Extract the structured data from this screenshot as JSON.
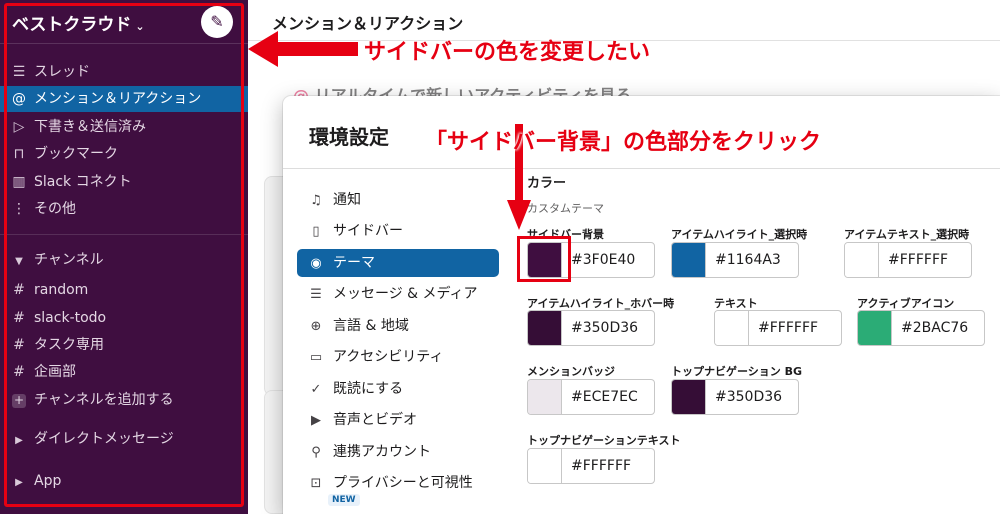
{
  "workspace": {
    "name": "ベストクラウド",
    "caret": "⌄"
  },
  "sidebar": {
    "top_items": [
      {
        "icon": "threads-icon",
        "glyph": "☰",
        "label": "スレッド"
      },
      {
        "icon": "mention-icon",
        "glyph": "@",
        "label": "メンション＆リアクション",
        "active": true
      },
      {
        "icon": "send-icon",
        "glyph": "▷",
        "label": "下書き＆送信済み"
      },
      {
        "icon": "bookmark-icon",
        "glyph": "⊓",
        "label": "ブックマーク"
      },
      {
        "icon": "building-icon",
        "glyph": "▥",
        "label": "Slack コネクト"
      },
      {
        "icon": "more-icon",
        "glyph": "⋮",
        "label": "その他"
      }
    ],
    "channels_header": "チャンネル",
    "channels": [
      {
        "glyph": "#",
        "label": "random"
      },
      {
        "glyph": "#",
        "label": "slack-todo"
      },
      {
        "glyph": "#",
        "label": "タスク専用"
      },
      {
        "glyph": "#",
        "label": "企画部"
      }
    ],
    "add_channel": "チャンネルを追加する",
    "dm_header": "ダイレクトメッセージ",
    "app_header": "App"
  },
  "main": {
    "title": "メンション＆リアクション",
    "background_line": "リアルタイムで新しいアクティビティを見る",
    "background_at": "@"
  },
  "dialog": {
    "title": "環境設定",
    "menu": [
      {
        "icon": "bell-icon",
        "glyph": "♫",
        "label": "通知"
      },
      {
        "icon": "sidebar-icon",
        "glyph": "▯",
        "label": "サイドバー"
      },
      {
        "icon": "eye-icon",
        "glyph": "◉",
        "label": "テーマ",
        "active": true
      },
      {
        "icon": "message-icon",
        "glyph": "☰",
        "label": "メッセージ & メディア"
      },
      {
        "icon": "globe-icon",
        "glyph": "⊕",
        "label": "言語 & 地域"
      },
      {
        "icon": "accessibility-icon",
        "glyph": "▭",
        "label": "アクセシビリティ"
      },
      {
        "icon": "check-circle-icon",
        "glyph": "✓",
        "label": "既読にする"
      },
      {
        "icon": "video-icon",
        "glyph": "▶",
        "label": "音声とビデオ"
      },
      {
        "icon": "plug-icon",
        "glyph": "⚲",
        "label": "連携アカウント"
      },
      {
        "icon": "lock-icon",
        "glyph": "⊡",
        "label": "プライバシーと可視性"
      }
    ],
    "new_badge": "NEW",
    "section_title": "カラー",
    "section_sub": "カスタムテーマ",
    "colors": [
      {
        "label": "サイドバー背景",
        "hex": "#3F0E40",
        "color": "#3f0e40"
      },
      {
        "label": "アイテムハイライト_選択時",
        "hex": "#1164A3",
        "color": "#1164a3"
      },
      {
        "label": "アイテムテキスト_選択時",
        "hex": "#FFFFFF",
        "color": "#ffffff"
      },
      {
        "label": "アイテムハイライト_ホバー時",
        "hex": "#350D36",
        "color": "#350d36"
      },
      {
        "label": "テキスト",
        "hex": "#FFFFFF",
        "color": "#ffffff"
      },
      {
        "label": "アクティブアイコン",
        "hex": "#2BAC76",
        "color": "#2bac76"
      },
      {
        "label": "メンションバッジ",
        "hex": "#ECE7EC",
        "color": "#ece7ec"
      },
      {
        "label": "トップナビゲーション BG",
        "hex": "#350D36",
        "color": "#350d36"
      },
      {
        "label": "トップナビゲーションテキスト",
        "hex": "#FFFFFF",
        "color": "#ffffff"
      }
    ]
  },
  "annotations": {
    "sidebar_note": "サイドバーの色を変更したい",
    "swatch_note": "「サイドバー背景」の色部分をクリック",
    "accent": "#e60012"
  }
}
